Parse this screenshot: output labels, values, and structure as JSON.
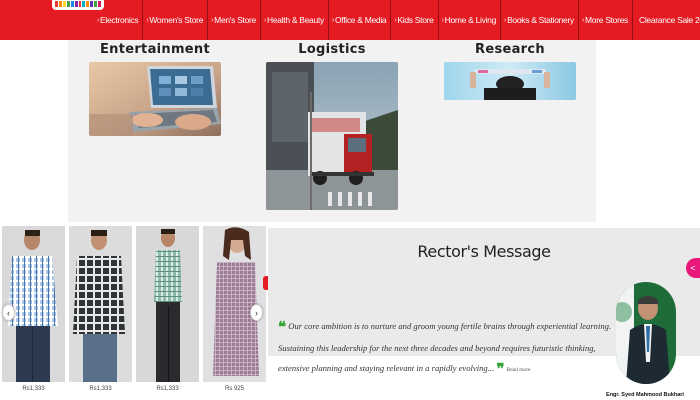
{
  "nav": {
    "items": [
      {
        "label": "Electronics"
      },
      {
        "label": "Women's Store"
      },
      {
        "label": "Men's Store"
      },
      {
        "label": "Health & Beauty"
      },
      {
        "label": "Office & Media"
      },
      {
        "label": "Kids Store"
      },
      {
        "label": "Home & Living"
      },
      {
        "label": "Books & Stationery"
      },
      {
        "label": "More Stores"
      }
    ],
    "sale_label": "Clearance Sale 2022",
    "chevron": "›"
  },
  "categories": {
    "entertainment": "Entertainment",
    "logistics": "Logistics",
    "research": "Research"
  },
  "products": {
    "prices": [
      "Rs1,333",
      "Rs1,333",
      "Rs1,333",
      "Rs 925"
    ],
    "prev_icon": "‹",
    "next_icon": "›"
  },
  "rector": {
    "title": "Rector's Message",
    "text": "Our core ambition is to nurture and groom young fertile brains through experiential learning. Sustaining this leadership for the next three decades and beyond requires futuristic thinking, extensive planning and staying relevant in a rapidly evolving...",
    "read_more": "Read more",
    "name": "Engr. Syed Mahmood Bukhari"
  },
  "share_icon": "<",
  "colors": {
    "brand_red": "#e41b23",
    "quote_green": "#3aa53a",
    "share_pink": "#e8197a"
  }
}
